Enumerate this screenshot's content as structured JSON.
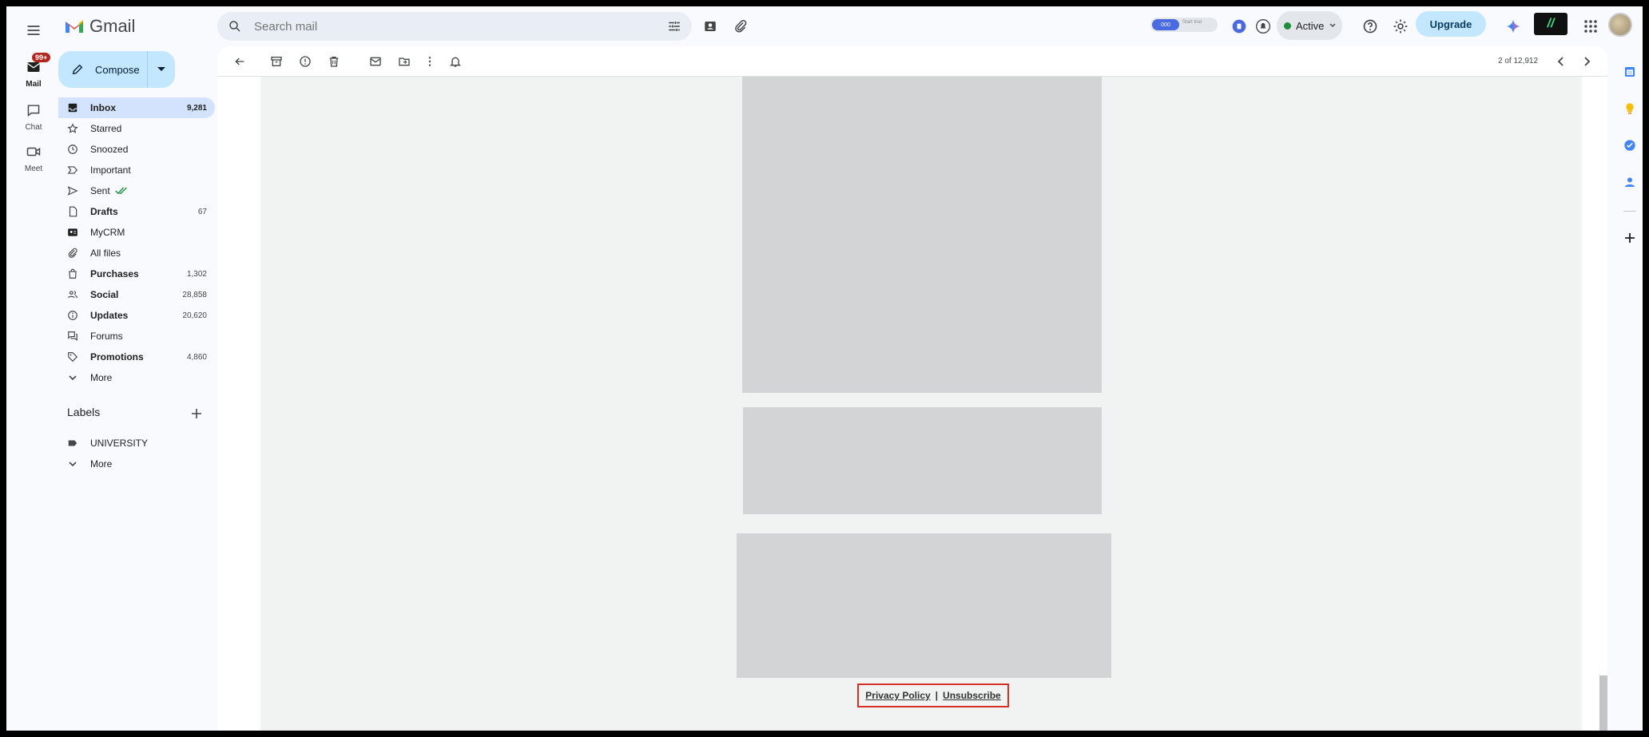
{
  "app": {
    "name": "Gmail"
  },
  "search": {
    "placeholder": "Search mail"
  },
  "header": {
    "status_label": "Active",
    "upgrade_label": "Upgrade",
    "ext_pill_left": "000",
    "ext_pill_right": "Start trial",
    "vbadge_label": "//"
  },
  "rail": {
    "mail_label": "Mail",
    "mail_badge": "99+",
    "chat_label": "Chat",
    "meet_label": "Meet"
  },
  "compose": {
    "label": "Compose"
  },
  "nav": {
    "items": [
      {
        "label": "Inbox",
        "count": "9,281"
      },
      {
        "label": "Starred",
        "count": ""
      },
      {
        "label": "Snoozed",
        "count": ""
      },
      {
        "label": "Important",
        "count": ""
      },
      {
        "label": "Sent",
        "count": ""
      },
      {
        "label": "Drafts",
        "count": "67"
      },
      {
        "label": "MyCRM",
        "count": ""
      },
      {
        "label": "All files",
        "count": ""
      },
      {
        "label": "Purchases",
        "count": "1,302"
      },
      {
        "label": "Social",
        "count": "28,858"
      },
      {
        "label": "Updates",
        "count": "20,620"
      },
      {
        "label": "Forums",
        "count": ""
      },
      {
        "label": "Promotions",
        "count": "4,860"
      },
      {
        "label": "More",
        "count": ""
      }
    ]
  },
  "labels": {
    "title": "Labels",
    "items": [
      {
        "label": "UNIVERSITY"
      },
      {
        "label": "More"
      }
    ]
  },
  "toolbar": {
    "pager": "2 of 12,912"
  },
  "email": {
    "privacy_label": "Privacy Policy",
    "separator": "|",
    "unsubscribe_label": "Unsubscribe"
  },
  "colors": {
    "accent": "#c2e7ff",
    "active_nav": "#d3e3fd",
    "highlight_box": "#d93025",
    "status_green": "#1e8e3e"
  }
}
